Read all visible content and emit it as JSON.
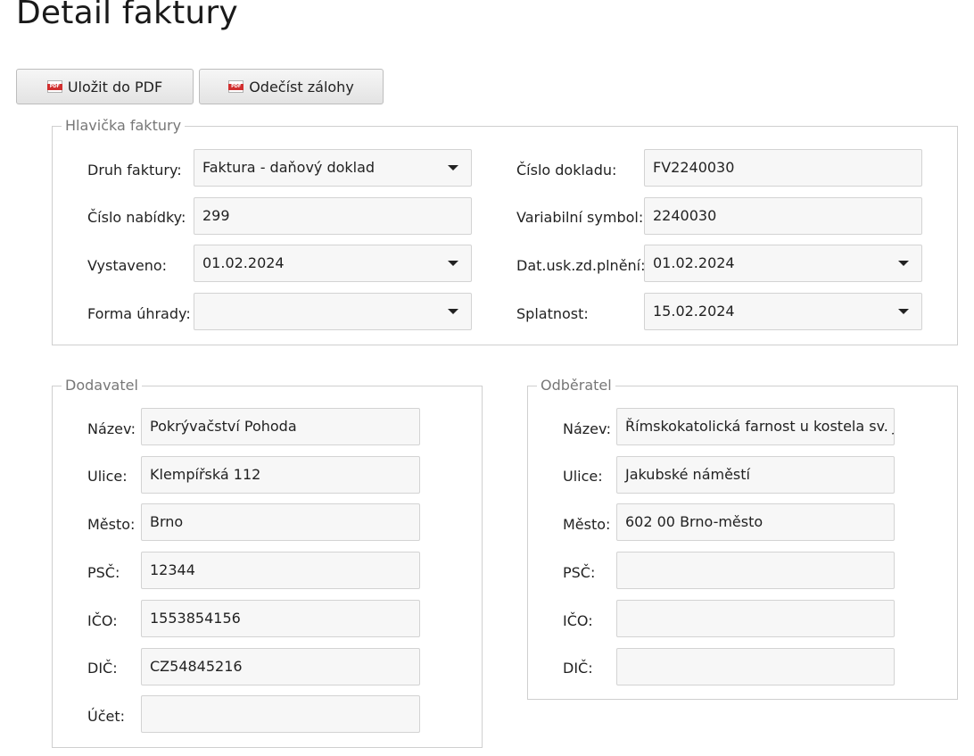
{
  "page": {
    "title": "Detail faktury"
  },
  "toolbar": {
    "save_pdf_label": "Uložit do PDF",
    "deduct_label": "Odečíst zálohy",
    "pdf_icon_text": "PDF"
  },
  "header": {
    "legend": "Hlavička faktury",
    "invoice_type": {
      "label": "Druh faktury:",
      "value": "Faktura - daňový doklad"
    },
    "offer_number": {
      "label": "Číslo nabídky:",
      "value": "299"
    },
    "issued": {
      "label": "Vystaveno:",
      "value": "01.02.2024"
    },
    "payment_form": {
      "label": "Forma úhrady:",
      "value": ""
    },
    "document_number": {
      "label": "Číslo dokladu:",
      "value": "FV2240030"
    },
    "variable_symbol": {
      "label": "Variabilní symbol:",
      "value": "2240030"
    },
    "taxable_date": {
      "label": "Dat.usk.zd.plnění:",
      "value": "01.02.2024"
    },
    "due_date": {
      "label": "Splatnost:",
      "value": "15.02.2024"
    }
  },
  "supplier": {
    "legend": "Dodavatel",
    "name": {
      "label": "Název:",
      "value": "Pokrývačství Pohoda"
    },
    "street": {
      "label": "Ulice:",
      "value": "Klempířská 112"
    },
    "city": {
      "label": "Město:",
      "value": "Brno"
    },
    "zip": {
      "label": "PSČ:",
      "value": "12344"
    },
    "ico": {
      "label": "IČO:",
      "value": "1553854156"
    },
    "dic": {
      "label": "DIČ:",
      "value": "CZ54845216"
    },
    "account": {
      "label": "Účet:",
      "value": ""
    }
  },
  "customer": {
    "legend": "Odběratel",
    "name": {
      "label": "Název:",
      "value": "Římskokatolická farnost u kostela sv. Jakuba"
    },
    "street": {
      "label": "Ulice:",
      "value": "Jakubské náměstí"
    },
    "city": {
      "label": "Město:",
      "value": "602 00 Brno-město"
    },
    "zip": {
      "label": "PSČ:",
      "value": ""
    },
    "ico": {
      "label": "IČO:",
      "value": ""
    },
    "dic": {
      "label": "DIČ:",
      "value": ""
    }
  }
}
